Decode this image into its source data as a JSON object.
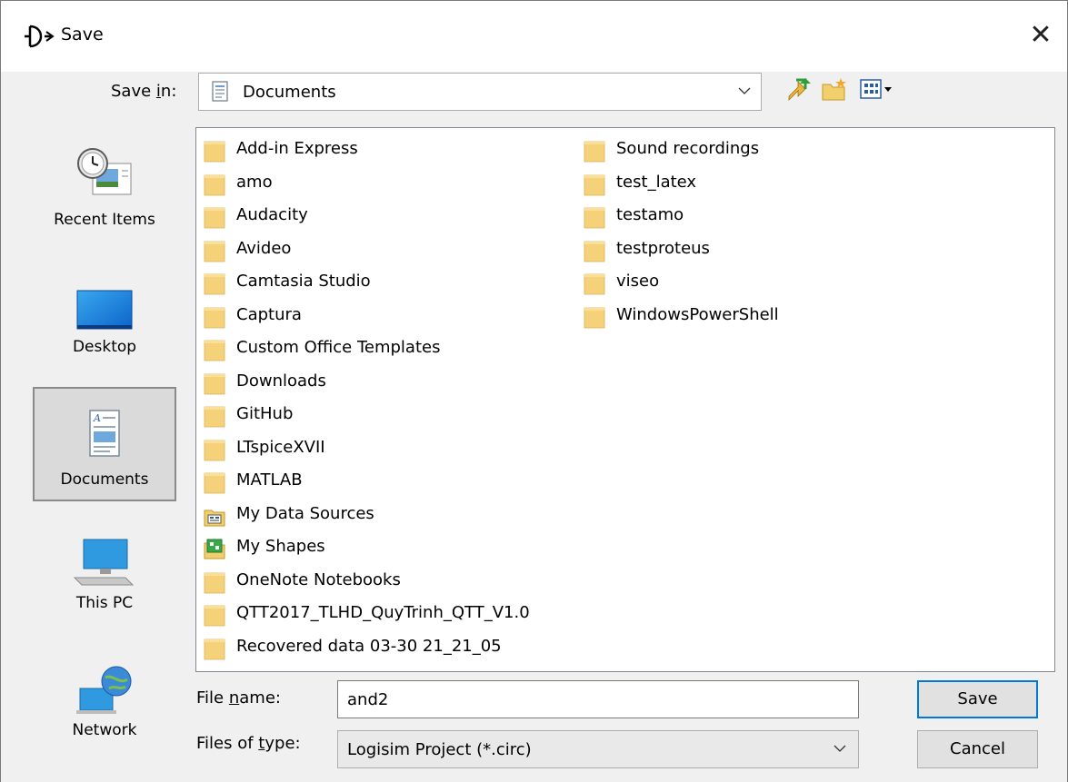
{
  "window": {
    "title": "Save"
  },
  "save_in": {
    "label_pre": "Save ",
    "label_key": "i",
    "label_post": "n:",
    "value": "Documents"
  },
  "places": [
    {
      "label": "Recent Items",
      "icon": "recent-items-icon"
    },
    {
      "label": "Desktop",
      "icon": "desktop-icon"
    },
    {
      "label": "Documents",
      "icon": "documents-icon",
      "selected": true
    },
    {
      "label": "This PC",
      "icon": "computer-icon"
    },
    {
      "label": "Network",
      "icon": "network-icon"
    }
  ],
  "files_col1": [
    {
      "name": "Add-in Express",
      "icon": "folder-icon"
    },
    {
      "name": "amo",
      "icon": "folder-icon"
    },
    {
      "name": "Audacity",
      "icon": "folder-icon"
    },
    {
      "name": "Avideo",
      "icon": "folder-icon"
    },
    {
      "name": "Camtasia Studio",
      "icon": "folder-icon"
    },
    {
      "name": "Captura",
      "icon": "folder-icon"
    },
    {
      "name": "Custom Office Templates",
      "icon": "folder-icon"
    },
    {
      "name": "Downloads",
      "icon": "folder-icon"
    },
    {
      "name": "GitHub",
      "icon": "folder-icon"
    },
    {
      "name": "LTspiceXVII",
      "icon": "folder-icon"
    },
    {
      "name": "MATLAB",
      "icon": "folder-icon"
    },
    {
      "name": "My Data Sources",
      "icon": "data-sources-folder-icon"
    },
    {
      "name": "My Shapes",
      "icon": "shapes-folder-icon"
    },
    {
      "name": "OneNote Notebooks",
      "icon": "folder-icon"
    },
    {
      "name": "QTT2017_TLHD_QuyTrinh_QTT_V1.0",
      "icon": "folder-icon"
    },
    {
      "name": "Recovered data 03-30 21_21_05",
      "icon": "folder-icon"
    }
  ],
  "files_col2": [
    {
      "name": "Sound recordings",
      "icon": "folder-icon"
    },
    {
      "name": "test_latex",
      "icon": "folder-icon"
    },
    {
      "name": "testamo",
      "icon": "folder-icon"
    },
    {
      "name": "testproteus",
      "icon": "folder-icon"
    },
    {
      "name": "viseo",
      "icon": "folder-icon"
    },
    {
      "name": "WindowsPowerShell",
      "icon": "folder-icon"
    }
  ],
  "file_name": {
    "label_pre": "File ",
    "label_key": "n",
    "label_post": "ame:",
    "value": "and2"
  },
  "file_type": {
    "label_pre": "Files of ",
    "label_key": "t",
    "label_post": "ype:",
    "value": "Logisim Project (*.circ)"
  },
  "buttons": {
    "save": "Save",
    "cancel": "Cancel"
  }
}
